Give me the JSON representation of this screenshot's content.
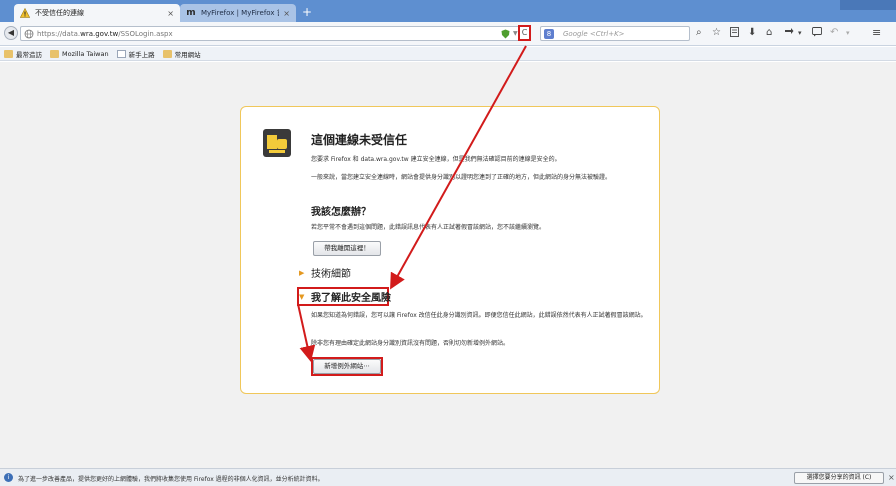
{
  "tabs": [
    {
      "title": "不受信任的連線",
      "close": "×",
      "icon": "warning-icon"
    },
    {
      "title": "MyFirefox | MyFirefox 首頁",
      "close": "×",
      "icon": "mozilla-m-icon",
      "icon_glyph": "m"
    }
  ],
  "newtab_label": "+",
  "nav": {
    "back_glyph": "◀",
    "url_prefix": "https://data.",
    "url_host": "wra.gov.tw",
    "url_path": "/SSOLogin.aspx",
    "reload_glyph": "C",
    "search_engine_glyph": "8",
    "search_placeholder": "Google <Ctrl+K>",
    "search_glyph": "⌕"
  },
  "bookmarks": [
    {
      "label": "最常造訪",
      "icon": "folder"
    },
    {
      "label": "Mozilla Taiwan",
      "icon": "folder"
    },
    {
      "label": "新手上路",
      "icon": "page"
    },
    {
      "label": "常用網站",
      "icon": "folder"
    }
  ],
  "error_page": {
    "title": "這個連線未受信任",
    "intro": "您要求 Firefox 和 data.wra.gov.tw 建立安全連線，但是我們無法確認目前的連線是安全的。",
    "explain": "一般來說，當您建立安全連線時，網站會提供身分識別以證明您連到了正確的地方，但此網站的身分無法被驗證。",
    "what_heading": "我該怎麼辦？",
    "what_text": "若您平常不會遇到這個問題，此錯誤訊息代表有人正試著假冒該網站，您不該繼續瀏覽。",
    "get_out_button": "帶我離開這裡！",
    "tech_details": "技術細節",
    "risk_heading": "我了解此安全風險",
    "risk_text": "如果您知道為何錯誤，您可以讓 Firefox 改信任此身分識別資訊。即便您信任此網站，此錯誤依然代表有人正試著假冒該網站。",
    "risk_text2": "除非您有理由確定此網站身分識別資訊沒有問題，否則切勿新增例外網站。",
    "add_exception_button": "新增例外網站⋯"
  },
  "notification": {
    "text": "為了進一步改善產品，提供您更好的上網體驗，我們將收集您使用 Firefox 過程的非個人化資訊，並分析統計資料。",
    "button": "選擇您要分享的資訊 (C)",
    "close": "×"
  },
  "colors": {
    "tabstrip": "#5e8fd0",
    "annotation_red": "#d21b1b",
    "box_border": "#f0c75a"
  }
}
